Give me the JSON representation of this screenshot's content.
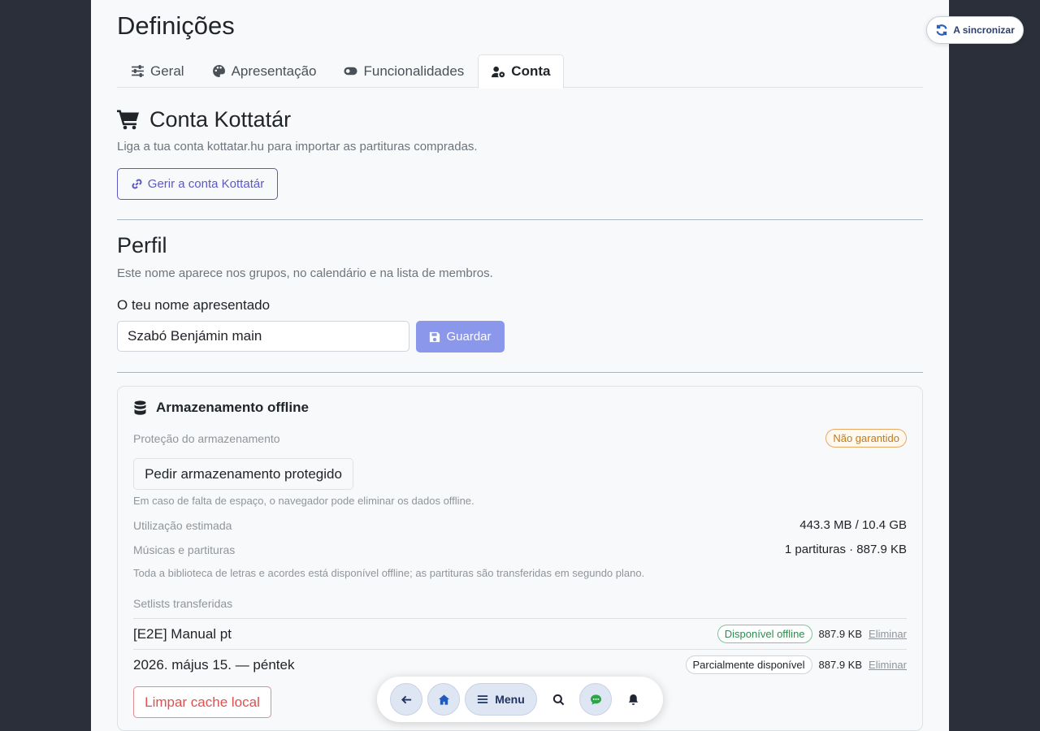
{
  "page": {
    "title": "Definições"
  },
  "tabs": [
    {
      "label": "Geral",
      "icon": "sliders-icon"
    },
    {
      "label": "Apresentação",
      "icon": "palette-icon"
    },
    {
      "label": "Funcionalidades",
      "icon": "toggle-icon"
    },
    {
      "label": "Conta",
      "icon": "user-gear-icon",
      "active": true
    }
  ],
  "kottatar": {
    "title": "Conta Kottatár",
    "description": "Liga a tua conta kottatar.hu para importar as partituras compradas.",
    "manage_button": "Gerir a conta Kottatár"
  },
  "profile": {
    "title": "Perfil",
    "description": "Este nome aparece nos grupos, no calendário e na lista de membros.",
    "name_label": "O teu nome apresentado",
    "name_value": "Szabó Benjámin main",
    "save_button": "Guardar"
  },
  "storage": {
    "title": "Armazenamento offline",
    "protection_label": "Proteção do armazenamento",
    "protection_badge": "Não garantido",
    "request_button": "Pedir armazenamento protegido",
    "warning_note": "Em caso de falta de espaço, o navegador pode eliminar os dados offline.",
    "usage_label": "Utilização estimada",
    "usage_value": "443.3 MB / 10.4 GB",
    "music_label": "Músicas e partituras",
    "music_value": "1 partituras · 887.9 KB",
    "library_note": "Toda a biblioteca de letras e acordes está disponível offline; as partituras são transferidas em segundo plano.",
    "setlists_label": "Setlists transferidas",
    "setlists": [
      {
        "name": "[E2E] Manual pt",
        "status": "Disponível offline",
        "size": "887.9 KB",
        "delete": "Eliminar"
      },
      {
        "name": "2026. május 15. — péntek",
        "status": "Parcialmente disponível",
        "size": "887.9 KB",
        "delete": "Eliminar"
      }
    ],
    "clear_button": "Limpar cache local"
  },
  "sync": {
    "label": "A sincronizar"
  },
  "dock": {
    "menu_label": "Menu"
  },
  "colors": {
    "accent": "#5b59c7",
    "save": "#8a97ea",
    "danger": "#dc5050",
    "success": "#2f8a4f",
    "warning": "#c17a16"
  }
}
